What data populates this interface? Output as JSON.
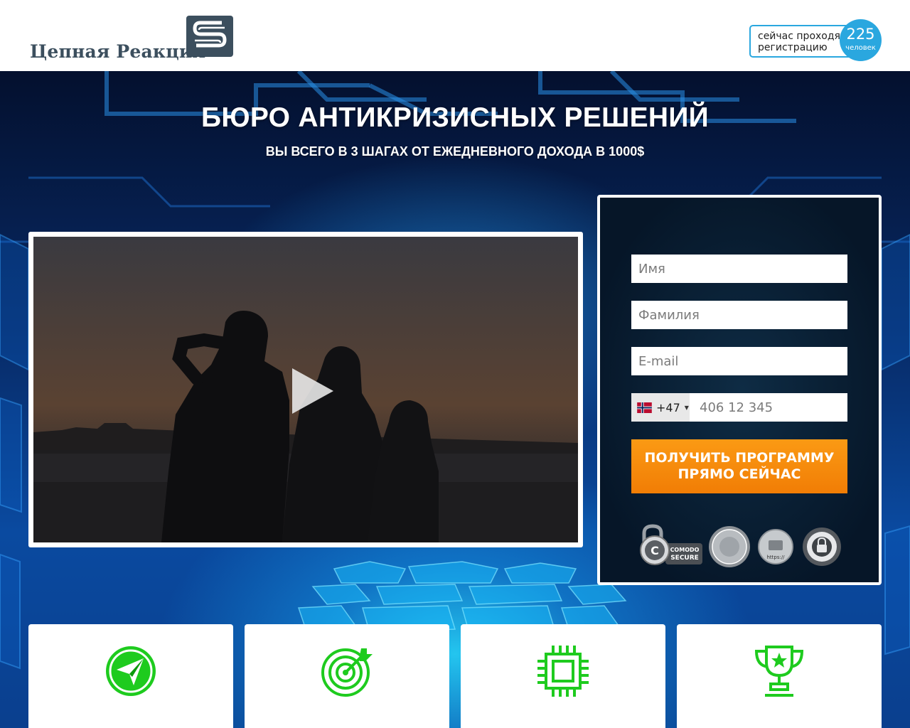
{
  "header": {
    "logo_text": "Цепная Реакция",
    "counter": {
      "line1": "сейчас проходят",
      "line2": "регистрацию",
      "count": "225",
      "unit": "человек"
    }
  },
  "hero": {
    "title": "БЮРО АНТИКРИЗИСНЫХ РЕШЕНИЙ",
    "subtitle": "ВЫ ВСЕГО В 3 ШАГАХ ОТ ЕЖЕДНЕВНОГО ДОХОДА В 1000$"
  },
  "video": {
    "play_icon": "play-icon"
  },
  "form": {
    "first_name_placeholder": "Имя",
    "last_name_placeholder": "Фамилия",
    "email_placeholder": "E-mail",
    "country_dial_code": "+47",
    "country_flag": "norway-flag-icon",
    "phone_placeholder": "406 12 345",
    "submit_line1": "ПОЛУЧИТЬ ПРОГРАММУ",
    "submit_line2": "ПРЯМО СЕЙЧАС",
    "badges": {
      "comodo_line1": "COMODO",
      "comodo_line2": "SECURE",
      "https_label": "https://"
    }
  },
  "features": [
    {
      "icon": "paper-plane-icon"
    },
    {
      "icon": "target-icon"
    },
    {
      "icon": "chip-icon"
    },
    {
      "icon": "trophy-icon"
    }
  ],
  "colors": {
    "accent_blue": "#2aa7df",
    "cta_orange": "#f58a0a",
    "icon_green": "#1ecb1e",
    "logo_slate": "#3c4f5e"
  }
}
